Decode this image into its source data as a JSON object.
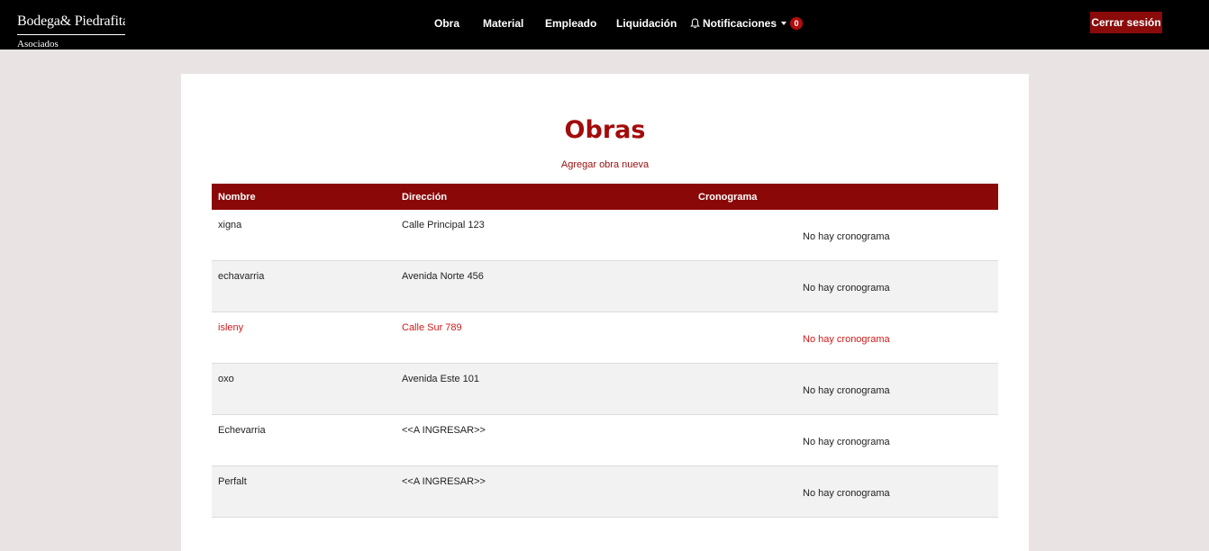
{
  "header": {
    "brand_name": "Bodega& Piedrafita",
    "brand_sub": "Asociados",
    "nav": [
      {
        "label": "Obra"
      },
      {
        "label": "Material"
      },
      {
        "label": "Empleado"
      },
      {
        "label": "Liquidación"
      }
    ],
    "notifications": {
      "label": "Notificaciones",
      "count": "0"
    },
    "logout_label": "Cerrar sesión"
  },
  "main": {
    "title": "Obras",
    "add_link": "Agregar obra nueva",
    "columns": [
      "Nombre",
      "Dirección",
      "Cronograma"
    ],
    "rows": [
      {
        "nombre": "xigna",
        "direccion": "Calle Principal 123",
        "cronograma": "No hay cronograma"
      },
      {
        "nombre": "echavarria",
        "direccion": "Avenida Norte 456",
        "cronograma": "No hay cronograma"
      },
      {
        "nombre": "isleny",
        "direccion": "Calle Sur 789",
        "cronograma": "No hay cronograma"
      },
      {
        "nombre": "oxo",
        "direccion": "Avenida Este 101",
        "cronograma": "No hay cronograma"
      },
      {
        "nombre": "Echevarria",
        "direccion": "<<A INGRESAR>>",
        "cronograma": "No hay cronograma"
      },
      {
        "nombre": "Perfalt",
        "direccion": "<<A INGRESAR>>",
        "cronograma": "No hay cronograma"
      }
    ]
  },
  "colors": {
    "header_bg": "#000000",
    "accent": "#8b0808",
    "title": "#a30b0b",
    "highlight_row_text": "#d21a1a",
    "page_bg": "#e9e3e3"
  }
}
